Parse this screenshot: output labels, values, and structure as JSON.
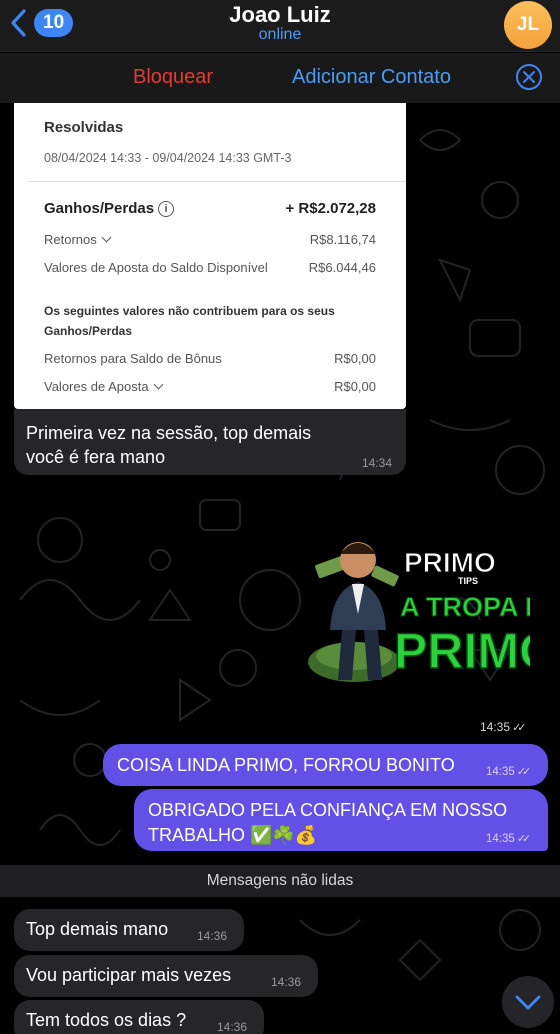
{
  "header": {
    "back_count": "10",
    "contact_name": "Joao Luiz",
    "status": "online",
    "avatar_initials": "JL"
  },
  "action_bar": {
    "block_label": "Bloquear",
    "add_contact_label": "Adicionar Contato"
  },
  "card": {
    "title": "Resolvidas",
    "period": "08/04/2024 14:33 - 09/04/2024 14:33 GMT-3",
    "rows": [
      {
        "label": "Ganhos/Perdas",
        "value": "+ R$2.072,28"
      },
      {
        "label": "Retornos",
        "value": "R$8.116,74"
      },
      {
        "label": "Valores de Aposta do Saldo Disponível",
        "value": "R$6.044,46"
      },
      {
        "label": "Retornos para Saldo de Bônus",
        "value": "R$0,00"
      },
      {
        "label": "Valores de Aposta",
        "value": "R$0,00"
      }
    ],
    "note": "Os seguintes valores não contribuem para os seus Ganhos/Perdas"
  },
  "messages": {
    "incoming_caption": {
      "line1": "Primeira vez na sessão, top demais",
      "line2": "você é fera mano",
      "time": "14:34"
    },
    "sticker": {
      "brand": "PRIMO",
      "brand_sub": "TIPS",
      "line1": "A TROPA DO",
      "line2": "PRIMO",
      "time": "14:35"
    },
    "outgoing": [
      {
        "text": "COISA LINDA PRIMO, FORROU BONITO",
        "time": "14:35"
      },
      {
        "line1": "OBRIGADO PELA CONFIANÇA EM NOSSO",
        "line2": "TRABALHO ✅☘️💰",
        "time": "14:35"
      }
    ],
    "unread_label": "Mensagens não lidas",
    "incoming": [
      {
        "text": "Top demais mano",
        "time": "14:36"
      },
      {
        "text": "Vou participar mais vezes",
        "time": "14:36"
      },
      {
        "text": "Tem todos os dias ?",
        "time": "14:36"
      }
    ]
  },
  "colors": {
    "accent": "#4a9cf5",
    "outgoing_bubble": "#6350e6",
    "incoming_bubble": "#262628",
    "danger": "#e53935",
    "avatar": "#f3a23b"
  },
  "icons": [
    "chevron-left-icon",
    "close-circle-icon",
    "info-icon",
    "chevron-down-icon",
    "double-check-icon",
    "scroll-down-icon"
  ]
}
